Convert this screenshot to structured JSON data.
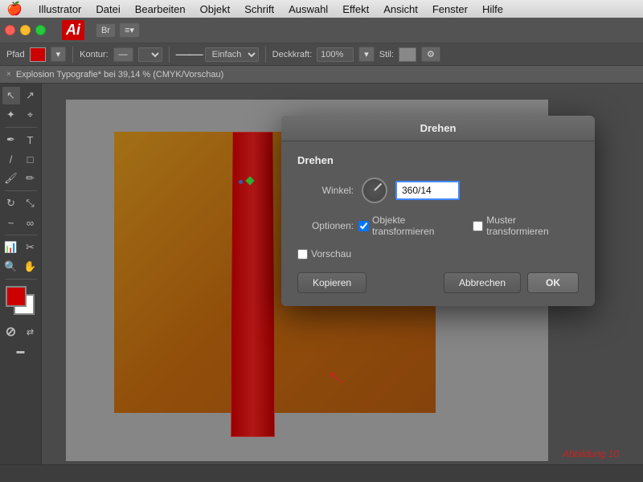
{
  "app": {
    "name": "Illustrator",
    "title": "Adobe Illustrator"
  },
  "menubar": {
    "apple": "🍎",
    "items": [
      "Illustrator",
      "Datei",
      "Bearbeiten",
      "Objekt",
      "Schrift",
      "Auswahl",
      "Effekt",
      "Ansicht",
      "Fenster",
      "Hilfe"
    ]
  },
  "toolbar": {
    "logo": "Ai",
    "workspace_btn": "Br",
    "arrange_btn": "≡▾"
  },
  "optionsbar": {
    "path_label": "Pfad",
    "kontur_label": "Kontur:",
    "stroke_label": "Einfach",
    "deckkraft_label": "Deckkraft:",
    "deckkraft_value": "100%",
    "stil_label": "Stil:"
  },
  "doctab": {
    "close": "×",
    "title": "Explosion Typografie* bei 39,14 % (CMYK/Vorschau)"
  },
  "dialog": {
    "title": "Drehen",
    "section": "Drehen",
    "winkel_label": "Winkel:",
    "winkel_value": "360/14",
    "optionen_label": "Optionen:",
    "checkbox1_label": "Objekte transformieren",
    "checkbox2_label": "Muster transformieren",
    "vorschau_label": "Vorschau",
    "btn_kopieren": "Kopieren",
    "btn_abbrechen": "Abbrechen",
    "btn_ok": "OK"
  },
  "statusbar": {
    "left": "",
    "caption": "Abbildung 10"
  },
  "colors": {
    "accent": "#cc0000",
    "highlight": "#4488ff",
    "dialog_bg": "#5a5a5a"
  }
}
